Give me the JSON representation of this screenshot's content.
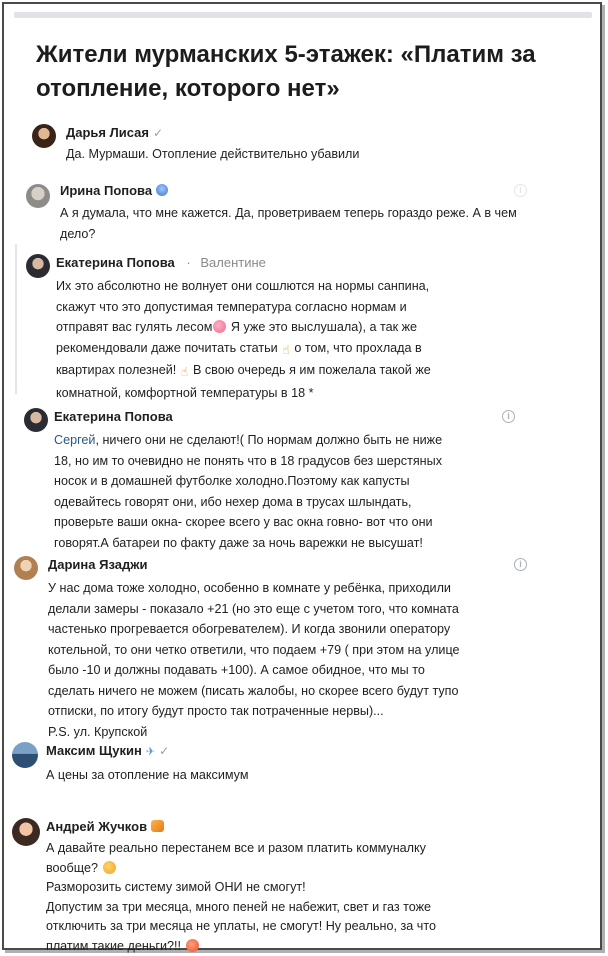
{
  "post": {
    "title": "Жители мурманских 5-этажек: «Платим за отопление, которого нет»"
  },
  "comments": [
    {
      "author": "Дарья Лисая",
      "verified_mark": "✓",
      "text": "Да. Мурмаши. Отопление действительно убавили"
    },
    {
      "author": "Ирина Попова",
      "text": "А я думала, что мне кажется. Да, проветриваем теперь гораздо реже. А в чем дело?"
    },
    {
      "author": "Екатерина Попова",
      "separator": "·",
      "reply_to": "Валентине",
      "lines": [
        "Их это абсолютно не волнует они сошлются на нормы санпина,",
        "скажут что это допустимая температура согласно нормам и",
        "отправят вас гулять лесом",
        " Я уже это выслушала), а так же",
        "рекомендовали даже почитать статьи ",
        " о том, что прохлада в",
        "квартирах полезней! ",
        " В свою очередь я им пожелала такой же",
        "комнатной, комфортной температуры в 18 *"
      ]
    },
    {
      "author": "Екатерина Попова",
      "reply_name": "Сергей",
      "lines": [
        ", ничего они не сделают!( По нормам должно быть не ниже",
        "18, но им то очевидно не понять что в 18 градусов без шерстяных",
        "носок и в домашней футболке холодно.Поэтому как капусты",
        "одевайтесь говорят они, ибо нехер дома в трусах шлындать,",
        "проверьте ваши окна- скорее всего у вас окна говно- вот что они",
        "говорят.А батареи по факту даже за ночь варежки не высушат!"
      ]
    },
    {
      "author": "Дарина Язаджи",
      "lines": [
        "У нас дома тоже холодно, особенно в комнате у ребёнка, приходили",
        "делали замеры - показало +21 (но это еще с учетом того, что комната",
        "частенько прогревается обогревателем). И когда звонили оператору",
        "котельной, то они четко ответили, что подаем +79 ( при этом на улице",
        "было -10 и должны подавать +100). А самое обидное, что мы то",
        "сделать ничего не можем (писать жалобы, но скорее всего будут тупо",
        "отписки, по итогу будут просто так потраченные нервы)...",
        "P.S. ул. Крупской"
      ]
    },
    {
      "author": "Максим Щукин",
      "verified_mark": "✓",
      "text": "А цены за отопление на максимум"
    },
    {
      "author": "Андрей Жучков",
      "lines": [
        "А давайте реально перестанем все и разом платить коммуналку",
        "вообще? ",
        "Разморозить систему зимой ОНИ не смогут!",
        "Допустим за три месяца, много пеней не набежит, свет и газ тоже",
        "отключить за три месяца не уплаты, не смогут! Ну реально, за что",
        "платим такие деньги?!! "
      ]
    }
  ],
  "icons": {
    "info": "i",
    "hand": "☝",
    "plane": "✈"
  },
  "colors": {
    "link": "#2a5885",
    "muted": "#8a8a8a"
  }
}
